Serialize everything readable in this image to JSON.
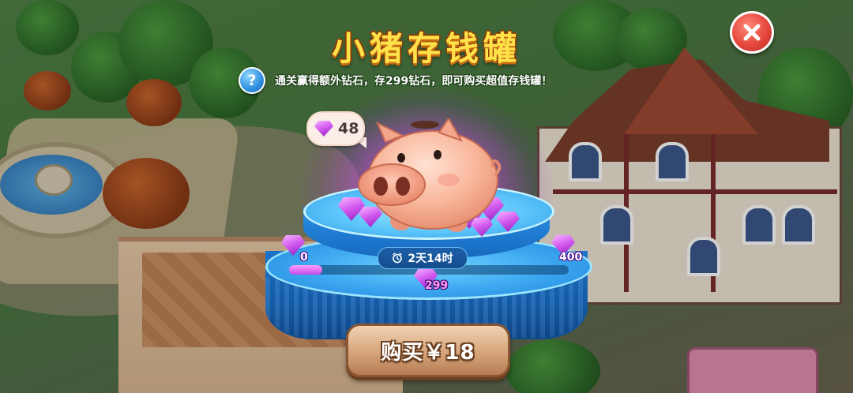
{
  "title": "小猪存钱罐",
  "help": {
    "button_glyph": "?",
    "text": "通关赢得额外钻石，存299钻石，即可购买超值存钱罐！"
  },
  "close_button": {
    "icon": "close-icon"
  },
  "balance": {
    "value": "48",
    "icon": "diamond-icon"
  },
  "timer": {
    "text": "2天14时",
    "icon": "alarm-clock-icon"
  },
  "progress": {
    "fraction": 0.12,
    "min_label": "0",
    "target_label": "299",
    "max_label": "400"
  },
  "buy_button": {
    "label": "购买￥18"
  },
  "colors": {
    "title_fill": "#ffe24a",
    "title_outline": "#c86b12",
    "gem": "#d45cf0",
    "pedestal": "#2f9be8",
    "buy_button": "#d9a97f",
    "close_button": "#e5473b"
  }
}
